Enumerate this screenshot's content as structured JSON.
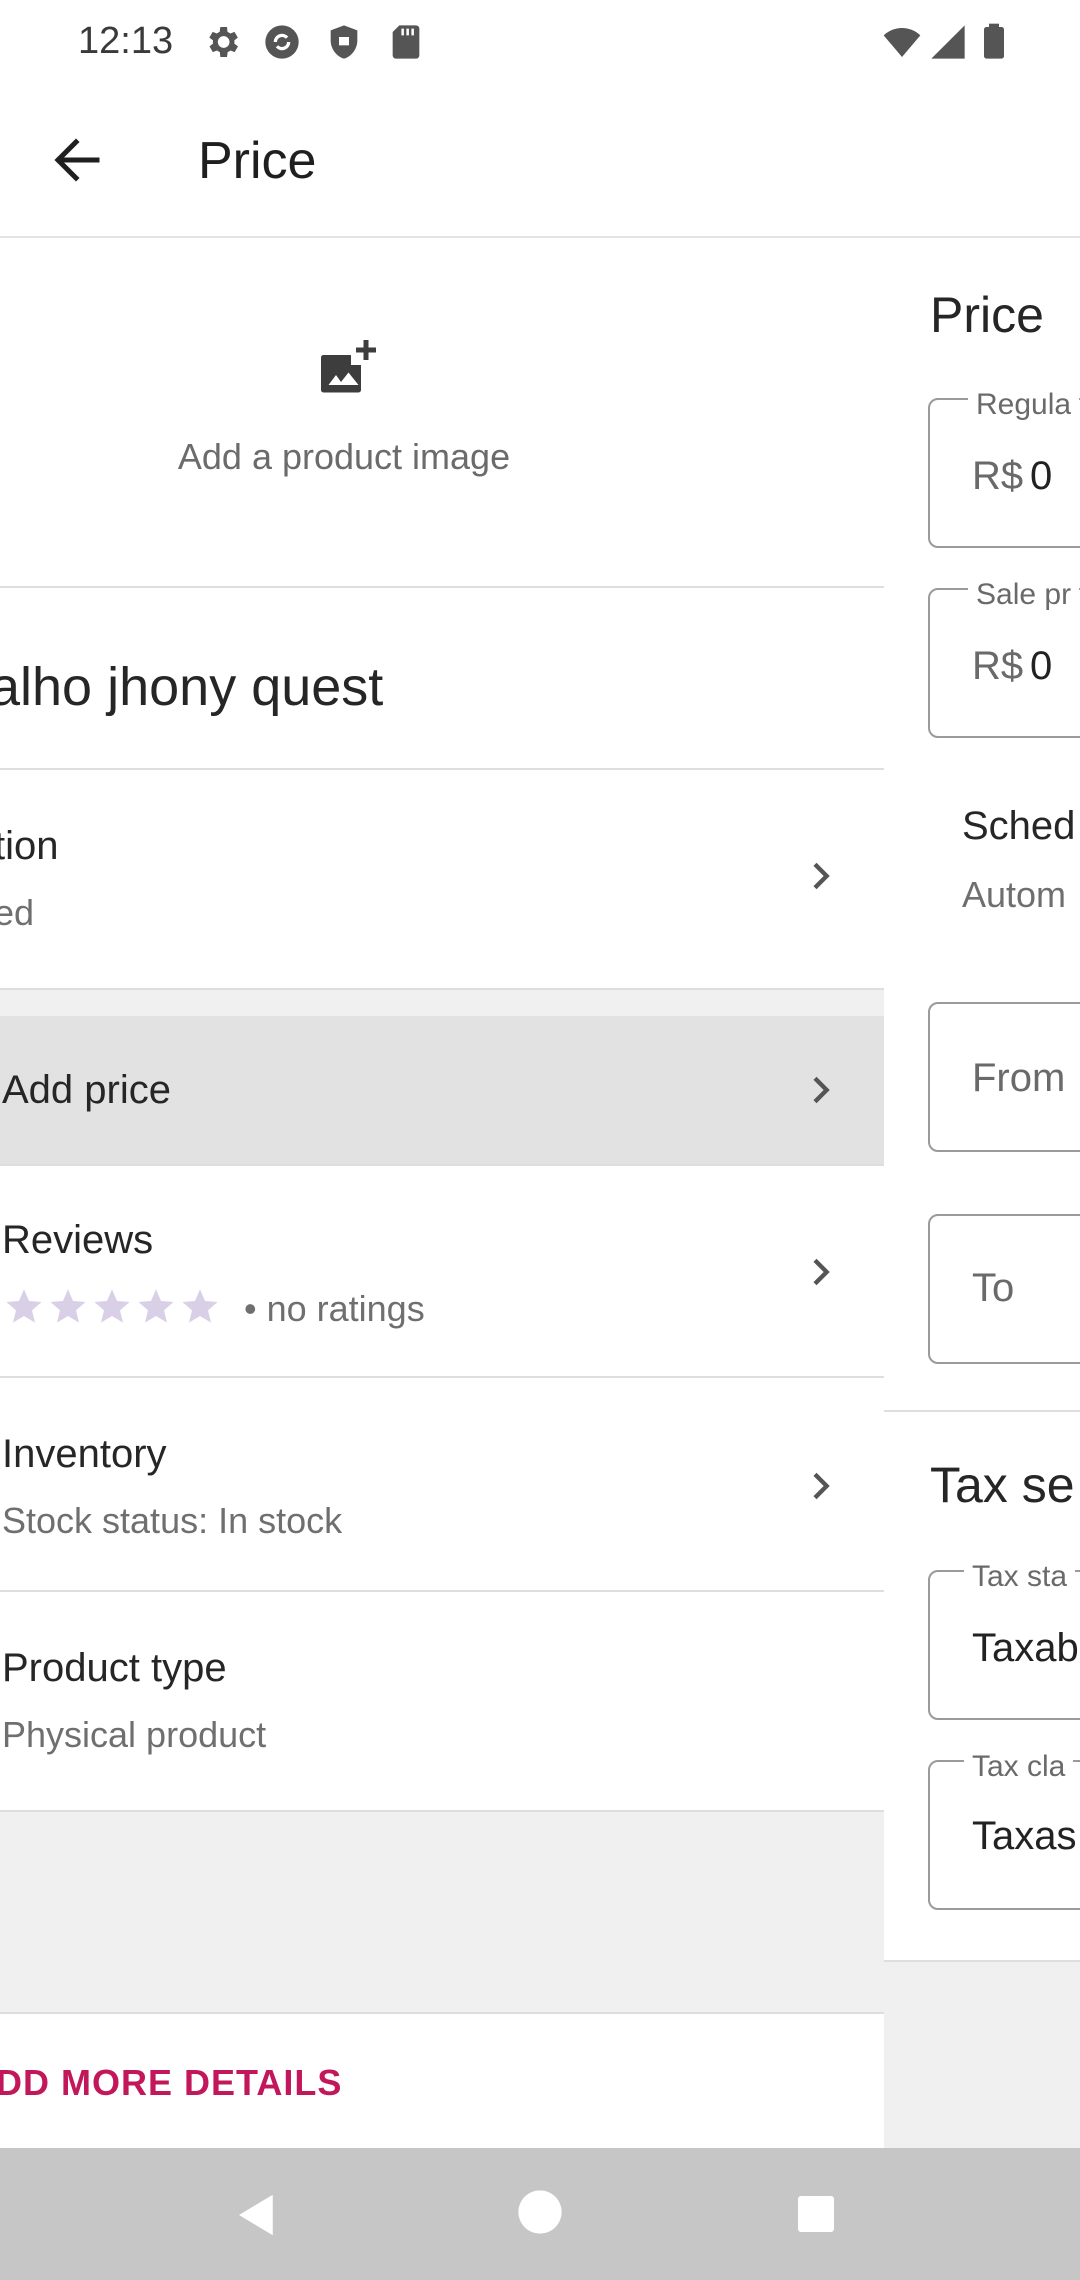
{
  "status_bar": {
    "time": "12:13",
    "left_icons": [
      "settings-icon",
      "sync-icon",
      "shield-icon",
      "sd-card-icon"
    ],
    "right_icons": [
      "wifi-icon",
      "cell-signal-icon",
      "battery-icon"
    ]
  },
  "app_bar": {
    "title": "Price",
    "back_icon": "arrow-back-icon"
  },
  "product": {
    "add_image_label": "Add a product image",
    "name": "alho jhony quest",
    "description_row": {
      "title": "tion",
      "subtitle": "ed"
    },
    "price_row": {
      "title": "Add price"
    },
    "reviews_row": {
      "title": "Reviews",
      "rating_stars": 5,
      "rating_text": "• no ratings"
    },
    "inventory_row": {
      "title": "Inventory",
      "subtitle": "Stock status: In stock"
    },
    "product_type_row": {
      "title": "Product type",
      "subtitle": "Physical product"
    },
    "more_details": "DD MORE DETAILS"
  },
  "price_panel": {
    "heading": "Price",
    "regular_price": {
      "label": "Regula",
      "currency": "R$",
      "value": "0"
    },
    "sale_price": {
      "label": "Sale pr",
      "currency": "R$",
      "value": "0"
    },
    "schedule": {
      "title": "Sched",
      "subtitle": "Autom"
    },
    "from_placeholder": "From",
    "to_placeholder": "To",
    "tax_heading": "Tax se",
    "tax_status": {
      "label": "Tax sta",
      "value": "Taxab"
    },
    "tax_class": {
      "label": "Tax cla",
      "value": "Taxas"
    }
  },
  "colors": {
    "accent": "#c2185b",
    "star": "#d9cfe6",
    "pressed_row": "#e2e2e2",
    "nav_bar": "#c6c6c6"
  },
  "nav_bar": {
    "back": "nav-back-icon",
    "home": "nav-home-icon",
    "recents": "nav-recents-icon"
  }
}
